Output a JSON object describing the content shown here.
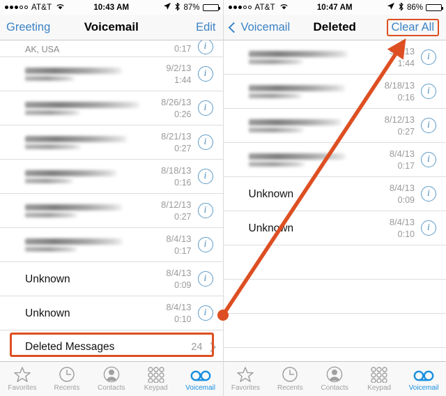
{
  "accent": {
    "orange": "#dd4f22",
    "ios_blue": "#3b82c4",
    "tab_blue": "#1a8fe0",
    "info_blue": "#5c9ac6"
  },
  "left_screen": {
    "status": {
      "signal_filled": 3,
      "signal_hollow": 2,
      "carrier": "AT&T",
      "wifi_icon": "wifi-icon",
      "time": "10:43 AM",
      "location_icon": "location-arrow-icon",
      "bluetooth_icon": "bluetooth-icon",
      "battery_pct": "87%"
    },
    "nav": {
      "left_label": "Greeting",
      "title": "Voicemail",
      "right_label": "Edit"
    },
    "rows": [
      {
        "name": "",
        "blurred_name": false,
        "sub": "AK, USA",
        "blurred_sub": false,
        "date": "",
        "duration": "0:17",
        "clipped": true
      },
      {
        "name": "",
        "blurred_name": true,
        "sub": "",
        "blurred_sub": true,
        "date": "9/2/13",
        "duration": "1:44",
        "clipped": false
      },
      {
        "name": "",
        "blurred_name": true,
        "sub": "",
        "blurred_sub": true,
        "date": "8/26/13",
        "duration": "0:26",
        "clipped": false
      },
      {
        "name": "",
        "blurred_name": true,
        "sub": "",
        "blurred_sub": true,
        "date": "8/21/13",
        "duration": "0:27",
        "clipped": false
      },
      {
        "name": "",
        "blurred_name": true,
        "sub": "",
        "blurred_sub": true,
        "date": "8/18/13",
        "duration": "0:16",
        "clipped": false
      },
      {
        "name": "",
        "blurred_name": true,
        "sub": "",
        "blurred_sub": true,
        "date": "8/12/13",
        "duration": "0:27",
        "clipped": false
      },
      {
        "name": "",
        "blurred_name": true,
        "sub": "",
        "blurred_sub": true,
        "date": "8/4/13",
        "duration": "0:17",
        "clipped": false
      },
      {
        "name": "Unknown",
        "blurred_name": false,
        "sub": "",
        "blurred_sub": false,
        "date": "8/4/13",
        "duration": "0:09",
        "clipped": false
      },
      {
        "name": "Unknown",
        "blurred_name": false,
        "sub": "",
        "blurred_sub": false,
        "date": "8/4/13",
        "duration": "0:10",
        "clipped": false
      }
    ],
    "deleted_messages": {
      "label": "Deleted Messages",
      "count": "24",
      "chevron_icon": "chevron-right-icon",
      "highlighted": true
    },
    "tabs": [
      {
        "label": "Favorites",
        "icon": "star-icon",
        "active": false
      },
      {
        "label": "Recents",
        "icon": "clock-icon",
        "active": false
      },
      {
        "label": "Contacts",
        "icon": "person-icon",
        "active": false
      },
      {
        "label": "Keypad",
        "icon": "keypad-icon",
        "active": false
      },
      {
        "label": "Voicemail",
        "icon": "voicemail-reels-icon",
        "active": true
      }
    ]
  },
  "right_screen": {
    "status": {
      "signal_filled": 3,
      "signal_hollow": 2,
      "carrier": "AT&T",
      "wifi_icon": "wifi-icon",
      "time": "10:47 AM",
      "location_icon": "location-arrow-icon",
      "bluetooth_icon": "bluetooth-icon",
      "battery_pct": "86%"
    },
    "nav": {
      "back_icon": "chevron-left-icon",
      "left_label": "Voicemail",
      "title": "Deleted",
      "right_label": "Clear All",
      "right_highlighted": true
    },
    "rows": [
      {
        "name": "",
        "blurred_name": true,
        "sub": "",
        "blurred_sub": true,
        "date": "9/2/13",
        "duration": "1:44",
        "clipped": false
      },
      {
        "name": "",
        "blurred_name": true,
        "sub": "",
        "blurred_sub": true,
        "date": "8/18/13",
        "duration": "0:16",
        "clipped": false
      },
      {
        "name": "",
        "blurred_name": true,
        "sub": "",
        "blurred_sub": true,
        "date": "8/12/13",
        "duration": "0:27",
        "clipped": false
      },
      {
        "name": "",
        "blurred_name": true,
        "sub": "",
        "blurred_sub": true,
        "date": "8/4/13",
        "duration": "0:17",
        "clipped": false
      },
      {
        "name": "Unknown",
        "blurred_name": false,
        "sub": "",
        "blurred_sub": false,
        "date": "8/4/13",
        "duration": "0:09",
        "clipped": false
      },
      {
        "name": "Unknown",
        "blurred_name": false,
        "sub": "",
        "blurred_sub": false,
        "date": "8/4/13",
        "duration": "0:10",
        "clipped": false
      }
    ],
    "empty_rows": 4,
    "tabs": [
      {
        "label": "Favorites",
        "icon": "star-icon",
        "active": false
      },
      {
        "label": "Recents",
        "icon": "clock-icon",
        "active": false
      },
      {
        "label": "Contacts",
        "icon": "person-icon",
        "active": false
      },
      {
        "label": "Keypad",
        "icon": "keypad-icon",
        "active": false
      },
      {
        "label": "Voicemail",
        "icon": "voicemail-reels-icon",
        "active": true
      }
    ]
  },
  "annotation": {
    "arrow_color": "#dd4f22",
    "from_label": "Deleted Messages row",
    "to_label": "Clear All button"
  }
}
